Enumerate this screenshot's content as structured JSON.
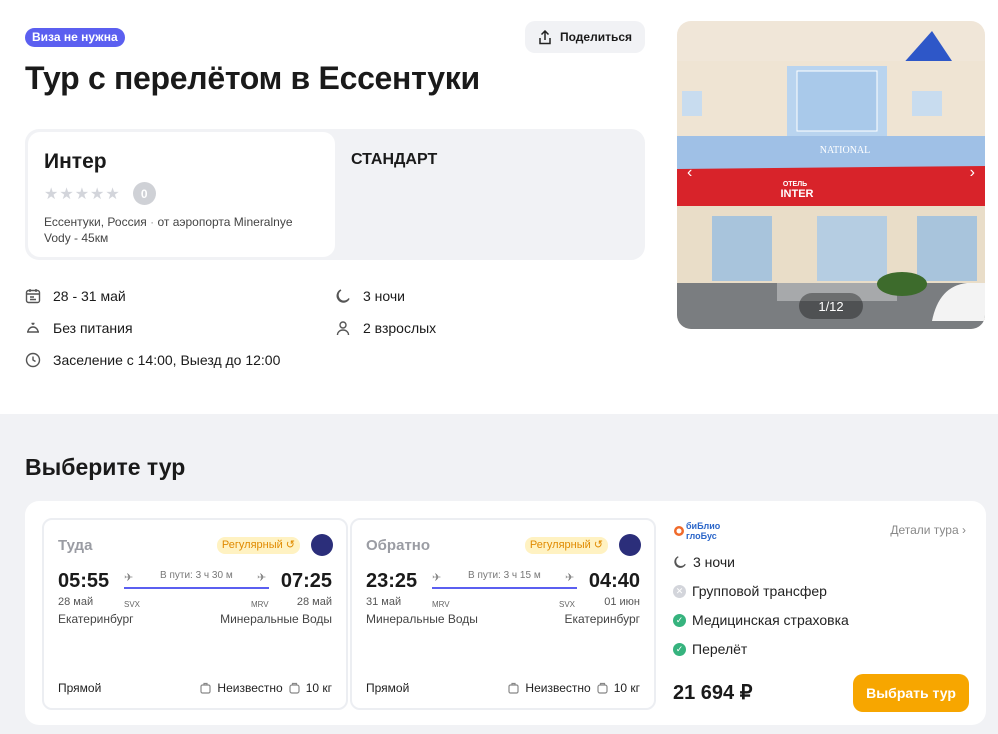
{
  "badge": "Виза не нужна",
  "share_label": "Поделиться",
  "title": "Тур с перелётом в Ессентуки",
  "hotel": {
    "name": "Интер",
    "stars_text": "★★★★★",
    "rating": "0",
    "location": "Ессентуки, Россия",
    "distance": "от аэропорта Mineralnye Vody - 45км",
    "room_type": "СТАНДАРТ"
  },
  "info": {
    "dates": "28 - 31 май",
    "nights": "3 ночи",
    "meal": "Без питания",
    "guests": "2 взрослых",
    "checkin": "Заселение с 14:00, Выезд до 12:00"
  },
  "photo": {
    "counter": "1/12",
    "sign_top": "NATIONAL",
    "sign_small": "ОТЕЛЬ",
    "sign_main": "INTER",
    "prev": "‹",
    "next": "›"
  },
  "section_title": "Выберите тур",
  "flights": [
    {
      "direction": "Туда",
      "regular": "Регулярный",
      "dep_time": "05:55",
      "dep_date": "28 май",
      "dep_code": "SVX",
      "dep_city": "Екатеринбург",
      "duration": "В пути: 3 ч 30 м",
      "arr_time": "07:25",
      "arr_date": "28 май",
      "arr_code": "MRV",
      "arr_city": "Минеральные Воды",
      "type": "Прямой",
      "baggage": "Неизвестно",
      "carry_on": "10 кг"
    },
    {
      "direction": "Обратно",
      "regular": "Регулярный",
      "dep_time": "23:25",
      "dep_date": "31 май",
      "dep_code": "MRV",
      "dep_city": "Минеральные Воды",
      "duration": "В пути: 3 ч 15 м",
      "arr_time": "04:40",
      "arr_date": "01 июн",
      "arr_code": "SVX",
      "arr_city": "Екатеринбург",
      "type": "Прямой",
      "baggage": "Неизвестно",
      "carry_on": "10 кг"
    }
  ],
  "operator": {
    "logo_top": "биБлио",
    "logo_bottom": "глоБус",
    "details": "Детали тура",
    "nights": "3 ночи",
    "features": [
      {
        "label": "Групповой трансфер",
        "included": false
      },
      {
        "label": "Медицинская страховка",
        "included": true
      },
      {
        "label": "Перелёт",
        "included": true
      }
    ],
    "price": "21 694 ₽",
    "buy_label": "Выбрать тур"
  },
  "colors": {
    "accent": "#5b5ff0",
    "cta": "#f7a600",
    "included": "#36b37e",
    "excluded": "#d3d5db"
  }
}
